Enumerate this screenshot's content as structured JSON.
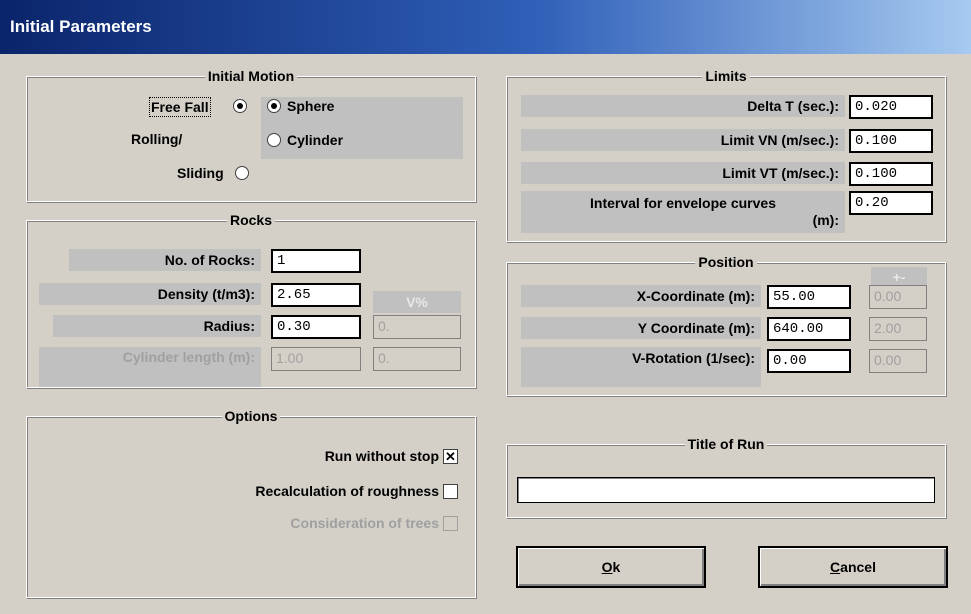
{
  "window": {
    "title": "Initial Parameters"
  },
  "initial_motion": {
    "title": "Initial Motion",
    "free_fall": "Free Fall",
    "rolling": "Rolling/",
    "sliding": "Sliding",
    "sphere": "Sphere",
    "cylinder": "Cylinder",
    "selected_motion": "Free Fall",
    "selected_shape": "Sphere"
  },
  "limits": {
    "title": "Limits",
    "rows": [
      {
        "label": "Delta T (sec.):",
        "value": "0.020"
      },
      {
        "label": "Limit VN (m/sec.):",
        "value": "0.100"
      },
      {
        "label": "Limit VT (m/sec.):",
        "value": "0.100"
      }
    ],
    "envelope_label_1": "Interval for envelope curves",
    "envelope_label_2": "(m):",
    "envelope_value": "0.20"
  },
  "rocks": {
    "title": "Rocks",
    "no_of_rocks_label": "No. of Rocks:",
    "no_of_rocks": "1",
    "density_label": "Density (t/m3):",
    "density": "2.65",
    "vpct_label": "V%",
    "radius_label": "Radius:",
    "radius": "0.30",
    "radius_vpct": "0.",
    "cyl_length_label": "Cylinder length (m):",
    "cyl_length": "1.00",
    "cyl_vpct": "0."
  },
  "position": {
    "title": "Position",
    "pm_label": "+-",
    "x_label": "X-Coordinate (m):",
    "x_value": "55.00",
    "x_pm": "0.00",
    "y_label": "Y Coordinate (m):",
    "y_value": "640.00",
    "y_pm": "2.00",
    "v_label": "V-Rotation (1/sec):",
    "v_value": "0.00",
    "v_pm": "0.00"
  },
  "options": {
    "title": "Options",
    "run_without_stop": "Run without stop",
    "run_without_stop_checked": true,
    "run_mark": "✕",
    "recalc": "Recalculation of roughness",
    "trees": "Consideration of trees"
  },
  "title_of_run": {
    "title": "Title of Run",
    "value": ""
  },
  "buttons": {
    "ok_u": "O",
    "ok_rest": "k",
    "cancel_u": "C",
    "cancel_rest": "ancel"
  }
}
